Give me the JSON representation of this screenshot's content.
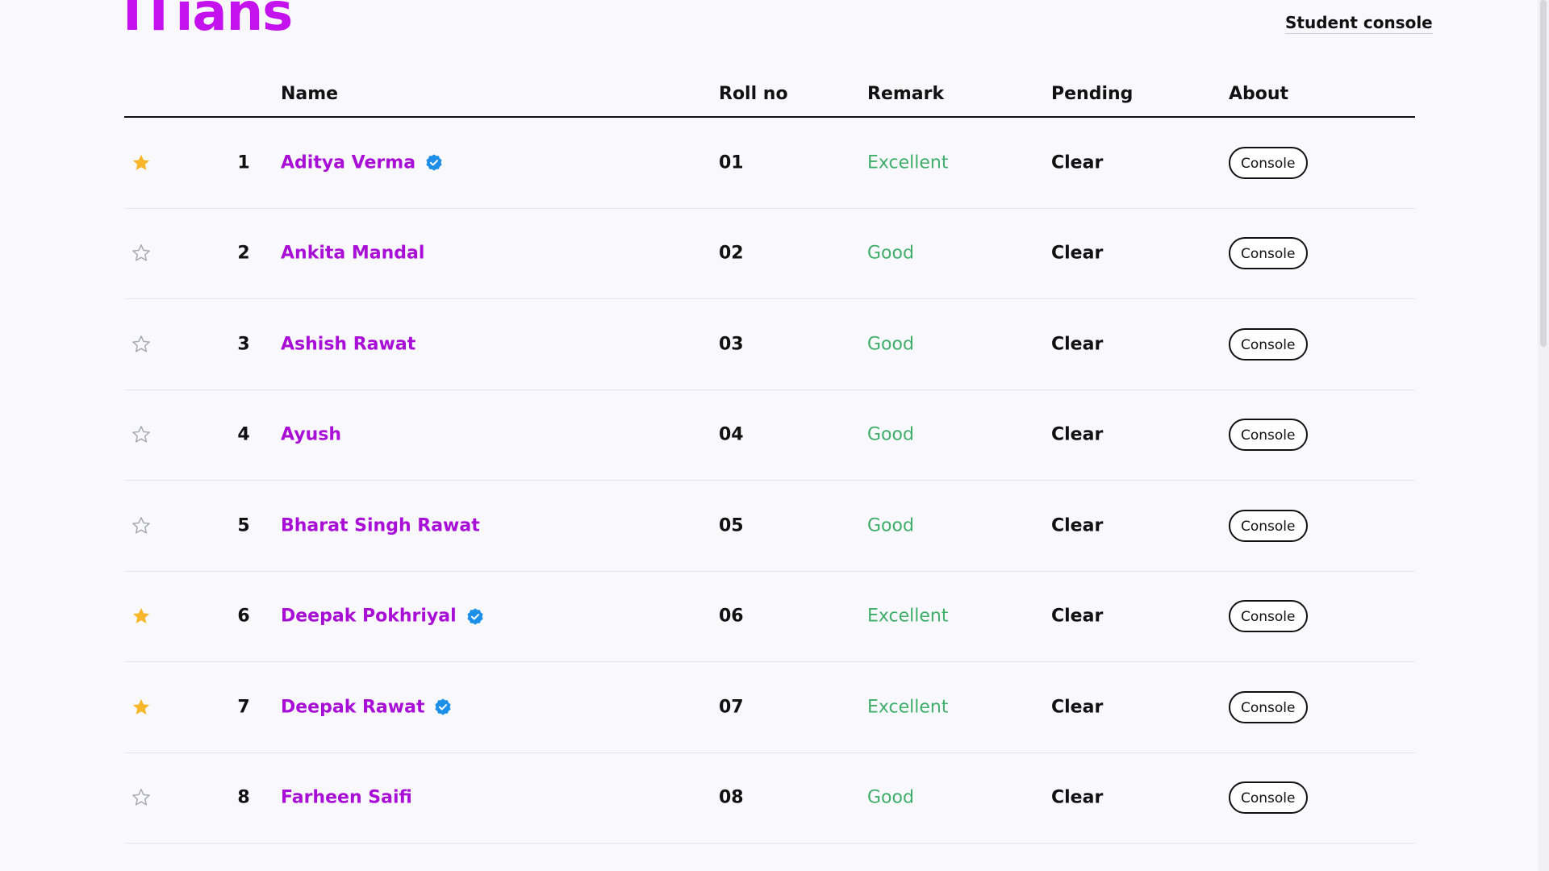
{
  "header": {
    "brand": "ITians",
    "nav_link": "Student console"
  },
  "table": {
    "columns": {
      "name": "Name",
      "roll": "Roll no",
      "remark": "Remark",
      "pending": "Pending",
      "about": "About"
    },
    "rows": [
      {
        "index": "1",
        "name": "Aditya Verma",
        "roll": "01",
        "remark": "Excellent",
        "pending": "Clear",
        "action": "Console",
        "starred": true,
        "verified": true
      },
      {
        "index": "2",
        "name": "Ankita Mandal",
        "roll": "02",
        "remark": "Good",
        "pending": "Clear",
        "action": "Console",
        "starred": false,
        "verified": false
      },
      {
        "index": "3",
        "name": "Ashish Rawat",
        "roll": "03",
        "remark": "Good",
        "pending": "Clear",
        "action": "Console",
        "starred": false,
        "verified": false
      },
      {
        "index": "4",
        "name": "Ayush",
        "roll": "04",
        "remark": "Good",
        "pending": "Clear",
        "action": "Console",
        "starred": false,
        "verified": false
      },
      {
        "index": "5",
        "name": "Bharat Singh Rawat",
        "roll": "05",
        "remark": "Good",
        "pending": "Clear",
        "action": "Console",
        "starred": false,
        "verified": false
      },
      {
        "index": "6",
        "name": "Deepak Pokhriyal",
        "roll": "06",
        "remark": "Excellent",
        "pending": "Clear",
        "action": "Console",
        "starred": true,
        "verified": true
      },
      {
        "index": "7",
        "name": "Deepak Rawat",
        "roll": "07",
        "remark": "Excellent",
        "pending": "Clear",
        "action": "Console",
        "starred": true,
        "verified": true
      },
      {
        "index": "8",
        "name": "Farheen Saifi",
        "roll": "08",
        "remark": "Good",
        "pending": "Clear",
        "action": "Console",
        "starred": false,
        "verified": false
      }
    ]
  },
  "icons": {
    "starred": "star-filled-icon",
    "unstarred": "star-outline-icon",
    "verified": "verified-badge-icon"
  },
  "colors": {
    "brand": "#c312ed",
    "name_link": "#a80ed6",
    "remark": "#3fae6a",
    "star_filled": "#f8b62a",
    "star_outline": "#a9a9b2",
    "verified": "#1d8fe8"
  }
}
